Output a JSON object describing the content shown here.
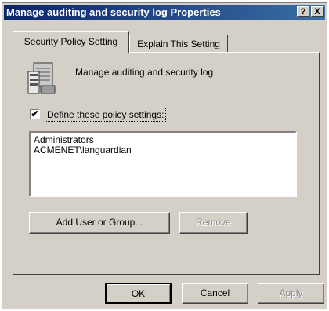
{
  "window": {
    "title": "Manage auditing and security log Properties",
    "help_glyph": "?",
    "close_glyph": "X"
  },
  "tabs": [
    {
      "label": "Security Policy Setting",
      "selected": true
    },
    {
      "label": "Explain This Setting",
      "selected": false
    }
  ],
  "policy": {
    "icon": "policy-server-icon",
    "name": "Manage auditing and security log"
  },
  "define": {
    "checked": true,
    "check_glyph": "✔",
    "label": "Define these policy settings:"
  },
  "principals": [
    "Administrators",
    "ACMENET\\languardian"
  ],
  "buttons": {
    "add": "Add User or Group...",
    "remove": "Remove",
    "ok": "OK",
    "cancel": "Cancel",
    "apply": "Apply"
  }
}
